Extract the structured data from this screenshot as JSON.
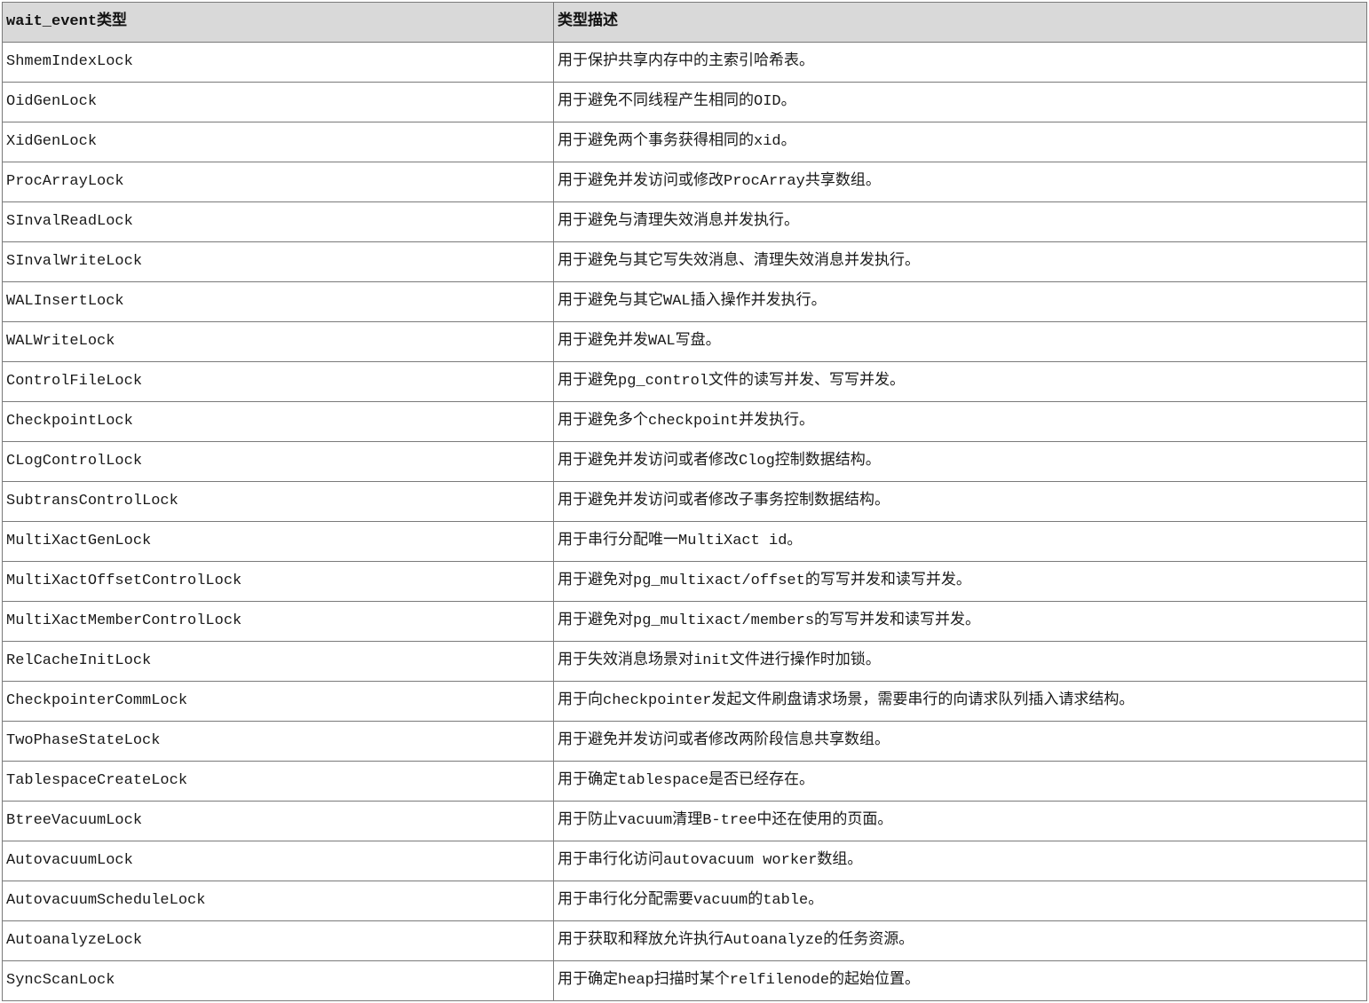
{
  "table": {
    "headers": [
      "wait_event类型",
      "类型描述"
    ],
    "rows": [
      [
        "ShmemIndexLock",
        "用于保护共享内存中的主索引哈希表。"
      ],
      [
        "OidGenLock",
        "用于避免不同线程产生相同的OID。"
      ],
      [
        "XidGenLock",
        "用于避免两个事务获得相同的xid。"
      ],
      [
        "ProcArrayLock",
        "用于避免并发访问或修改ProcArray共享数组。"
      ],
      [
        "SInvalReadLock",
        "用于避免与清理失效消息并发执行。"
      ],
      [
        "SInvalWriteLock",
        "用于避免与其它写失效消息、清理失效消息并发执行。"
      ],
      [
        "WALInsertLock",
        "用于避免与其它WAL插入操作并发执行。"
      ],
      [
        "WALWriteLock",
        "用于避免并发WAL写盘。"
      ],
      [
        "ControlFileLock",
        "用于避免pg_control文件的读写并发、写写并发。"
      ],
      [
        "CheckpointLock",
        "用于避免多个checkpoint并发执行。"
      ],
      [
        "CLogControlLock",
        "用于避免并发访问或者修改Clog控制数据结构。"
      ],
      [
        "SubtransControlLock",
        "用于避免并发访问或者修改子事务控制数据结构。"
      ],
      [
        "MultiXactGenLock",
        "用于串行分配唯一MultiXact id。"
      ],
      [
        "MultiXactOffsetControlLock",
        "用于避免对pg_multixact/offset的写写并发和读写并发。"
      ],
      [
        "MultiXactMemberControlLock",
        "用于避免对pg_multixact/members的写写并发和读写并发。"
      ],
      [
        "RelCacheInitLock",
        "用于失效消息场景对init文件进行操作时加锁。"
      ],
      [
        "CheckpointerCommLock",
        "用于向checkpointer发起文件刷盘请求场景，需要串行的向请求队列插入请求结构。"
      ],
      [
        "TwoPhaseStateLock",
        "用于避免并发访问或者修改两阶段信息共享数组。"
      ],
      [
        "TablespaceCreateLock",
        "用于确定tablespace是否已经存在。"
      ],
      [
        "BtreeVacuumLock",
        "用于防止vacuum清理B-tree中还在使用的页面。"
      ],
      [
        "AutovacuumLock",
        "用于串行化访问autovacuum worker数组。"
      ],
      [
        "AutovacuumScheduleLock",
        "用于串行化分配需要vacuum的table。"
      ],
      [
        "AutoanalyzeLock",
        "用于获取和释放允许执行Autoanalyze的任务资源。"
      ],
      [
        "SyncScanLock",
        "用于确定heap扫描时某个relfilenode的起始位置。"
      ]
    ]
  }
}
